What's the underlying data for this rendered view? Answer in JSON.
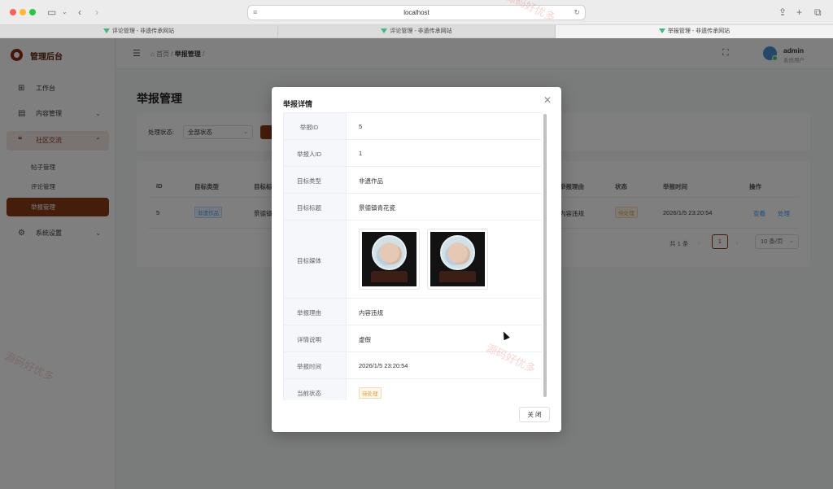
{
  "browser": {
    "url": "localhost",
    "tabs": [
      "评论管理 - 非遗传承网站",
      "评论管理 - 非遗传承网站",
      "举报管理 - 非遗传承网站"
    ]
  },
  "sidebar": {
    "brand": "管理后台",
    "items": [
      {
        "label": "工作台",
        "icon": "dashboard-icon"
      },
      {
        "label": "内容管理",
        "icon": "document-icon"
      },
      {
        "label": "社区交流",
        "icon": "chat-icon"
      },
      {
        "label": "系统设置",
        "icon": "gear-icon"
      }
    ],
    "subitems": [
      "帖子管理",
      "评论管理",
      "举报管理"
    ]
  },
  "header": {
    "breadcrumb_home": "首页",
    "breadcrumb_current": "举报管理",
    "user_name": "admin",
    "user_role": "系统用户"
  },
  "main": {
    "title": "举报管理",
    "filter_label": "处理状态:",
    "filter_value": "全部状态",
    "columns": [
      "ID",
      "目标类型",
      "目标标",
      "举报理由",
      "状态",
      "举报时间",
      "操作"
    ],
    "row": {
      "id": "5",
      "target_type": "非遗作品",
      "target_title": "景德镇",
      "reason": "内容违规",
      "status": "待处理",
      "time": "2026/1/5 23:20:54",
      "view": "查看",
      "handle": "处理"
    },
    "pager": {
      "total": "共 1 条",
      "page": "1",
      "size": "10 条/页"
    }
  },
  "dialog": {
    "title": "举报详情",
    "labels": {
      "id": "举报ID",
      "reporter": "举报人ID",
      "type": "目标类型",
      "title": "目标标题",
      "media": "目标媒体",
      "reason": "举报理由",
      "detail": "详情说明",
      "time": "举报时间",
      "status": "当前状态"
    },
    "values": {
      "id": "5",
      "reporter": "1",
      "type": "非遗作品",
      "title": "景德镇青花瓷",
      "reason": "内容违规",
      "detail": "虚假",
      "time": "2026/1/5 23:20:54",
      "status": "待处理"
    },
    "close_label": "关 闭"
  },
  "watermark": "源码好优多"
}
